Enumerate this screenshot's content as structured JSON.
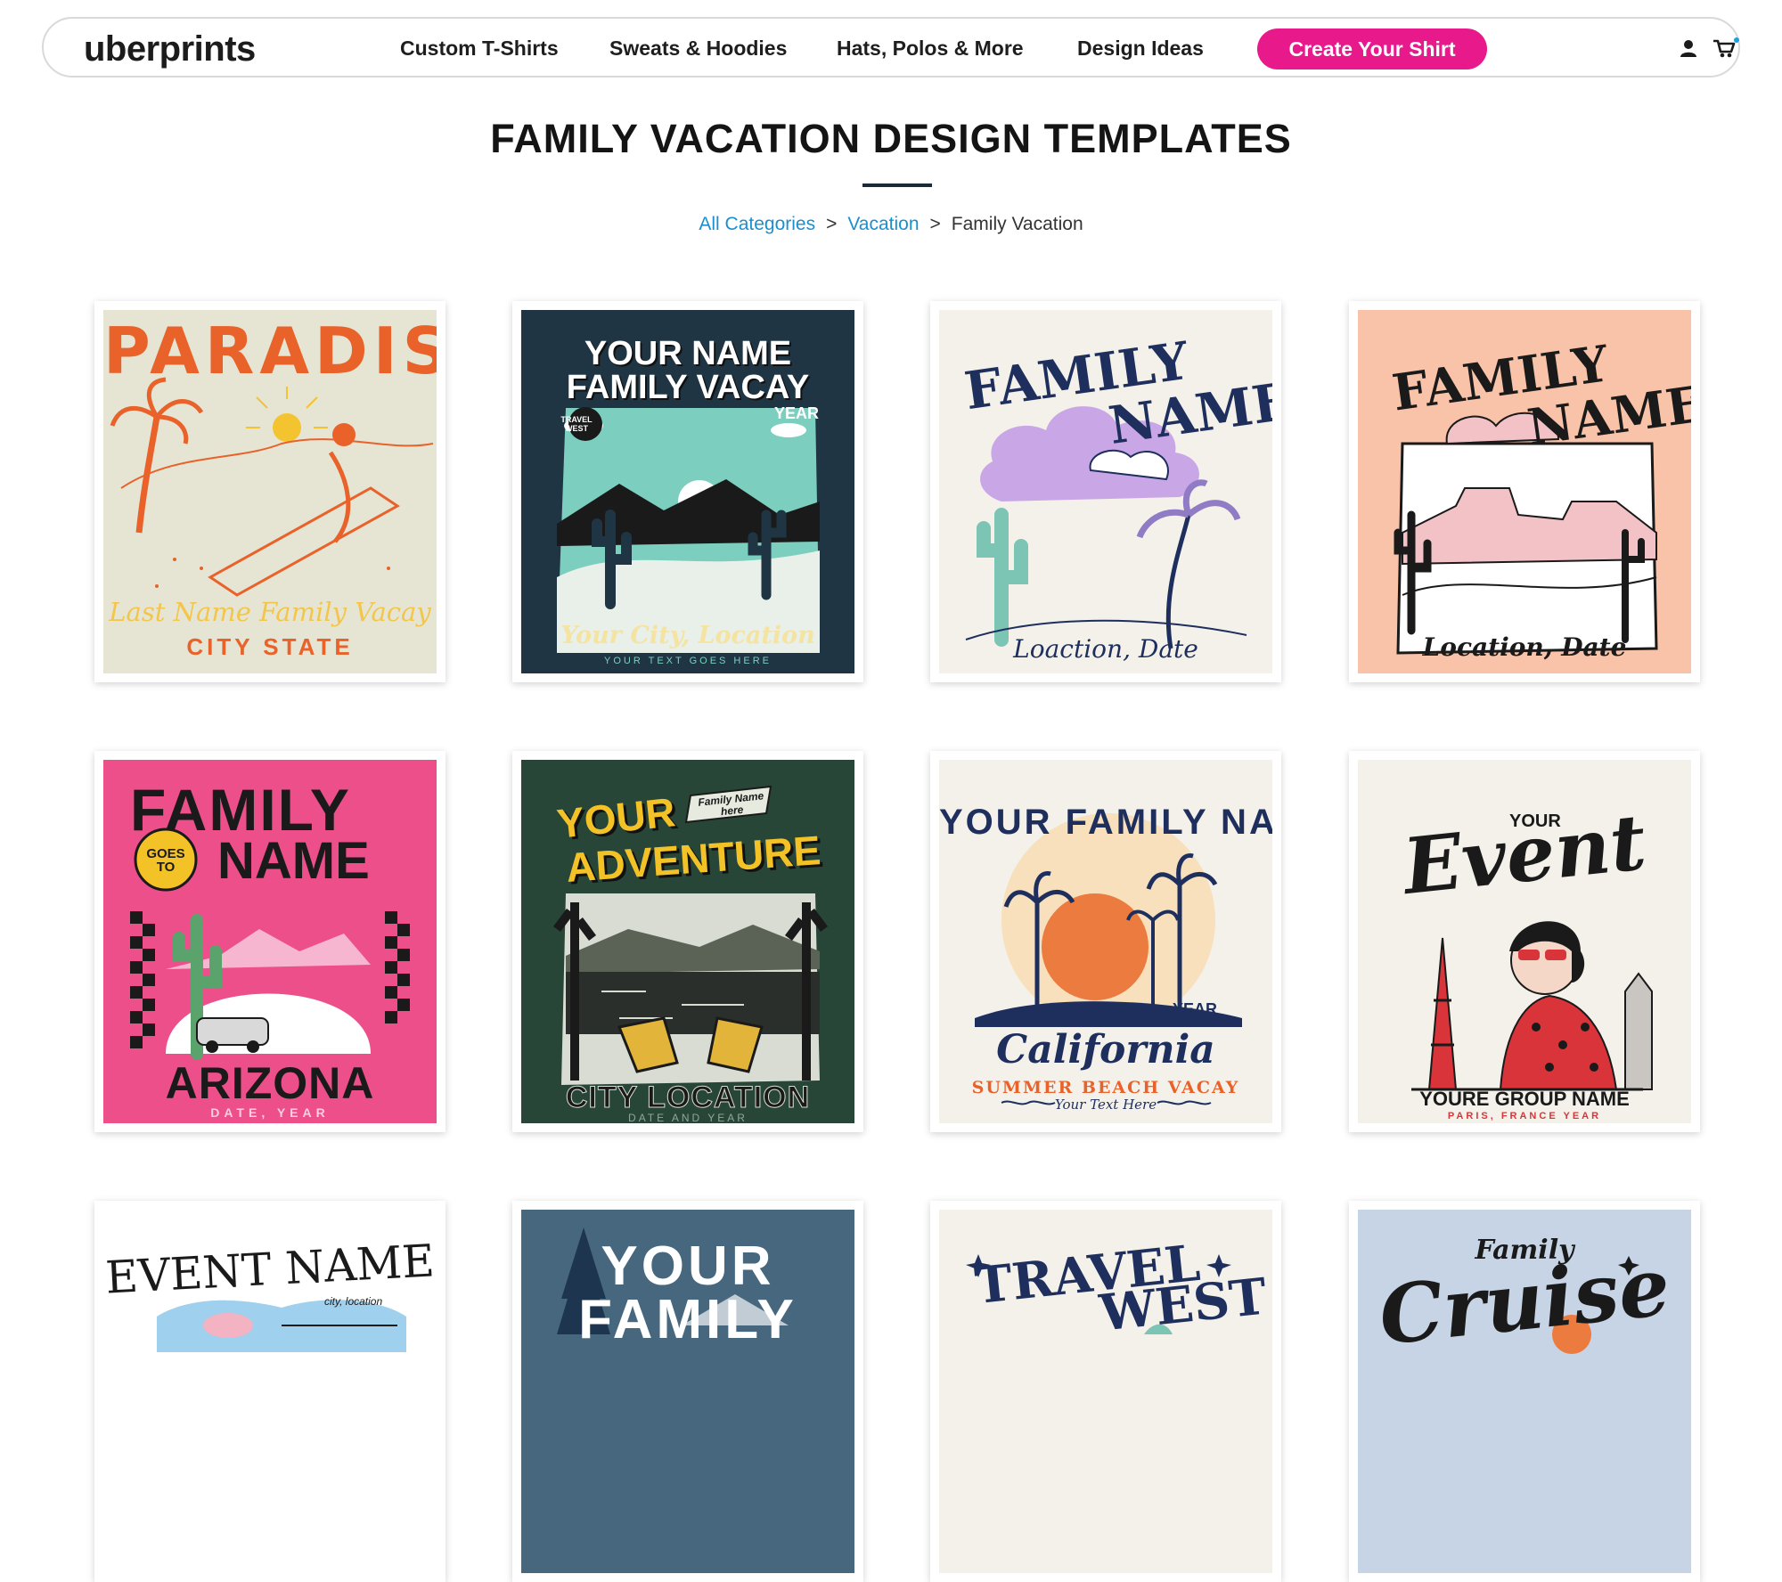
{
  "header": {
    "logo": "uberprints",
    "nav": [
      "Custom T-Shirts",
      "Sweats & Hoodies",
      "Hats, Polos & More",
      "Design Ideas"
    ],
    "cta": "Create Your Shirt",
    "icons": [
      "user-icon",
      "cart-icon"
    ],
    "accent_color": "#e8198b"
  },
  "page": {
    "title": "FAMILY VACATION DESIGN TEMPLATES",
    "breadcrumb": [
      "All Categories",
      "Vacation",
      "Family Vacation"
    ],
    "breadcrumb_separator": ">"
  },
  "templates": [
    {
      "lines": [
        "PARADISE",
        "Last Name Family Vacay",
        "CITY STATE"
      ],
      "bg": "#e6e5d3",
      "ink": "#e8622a"
    },
    {
      "lines": [
        "YOUR NAME",
        "FAMILY VACAY",
        "TRAVEL WEST",
        "YEAR",
        "Your City, Location",
        "YOUR TEXT GOES HERE"
      ],
      "bg": "#1f3544",
      "ink": "#7ccfbf"
    },
    {
      "lines": [
        "FAMILY",
        "NAME",
        "Loaction, Date"
      ],
      "bg": "#f4f1ea",
      "ink": "#1e2f5e"
    },
    {
      "lines": [
        "FAMILY",
        "NAME",
        "Location, Date"
      ],
      "bg": "#f9c3a9",
      "ink": "#1a1a1a"
    },
    {
      "lines": [
        "FAMILY",
        "NAME",
        "GOES TO",
        "ARIZONA",
        "DATE, YEAR"
      ],
      "bg": "#ec4f8a",
      "ink": "#1a1a1a"
    },
    {
      "lines": [
        "YOUR",
        "ADVENTURE",
        "Family Name here",
        "CITY LOCATION",
        "DATE AND YEAR"
      ],
      "bg": "#284638",
      "ink": "#f3c227"
    },
    {
      "lines": [
        "YOUR FAMILY NAME",
        "YEAR",
        "California",
        "SUMMER BEACH VACAY",
        "Your Text Here"
      ],
      "bg": "#f4f1ea",
      "ink": "#1e2f5e"
    },
    {
      "lines": [
        "YOUR",
        "Event",
        "YOURE GROUP NAME",
        "PARIS, FRANCE YEAR"
      ],
      "bg": "#f4f1ea",
      "ink": "#1a1a1a"
    },
    {
      "lines": [
        "EVENT NAME",
        "city, location"
      ],
      "bg": "#ffffff",
      "ink": "#1a1a1a"
    },
    {
      "lines": [
        "YOUR",
        "FAMILY"
      ],
      "bg": "#46677e",
      "ink": "#ffffff"
    },
    {
      "lines": [
        "TRAVEL",
        "WEST"
      ],
      "bg": "#f4f1ea",
      "ink": "#1e2f5e"
    },
    {
      "lines": [
        "Family",
        "Cruise"
      ],
      "bg": "#c6d4e6",
      "ink": "#1a1a1a"
    }
  ]
}
